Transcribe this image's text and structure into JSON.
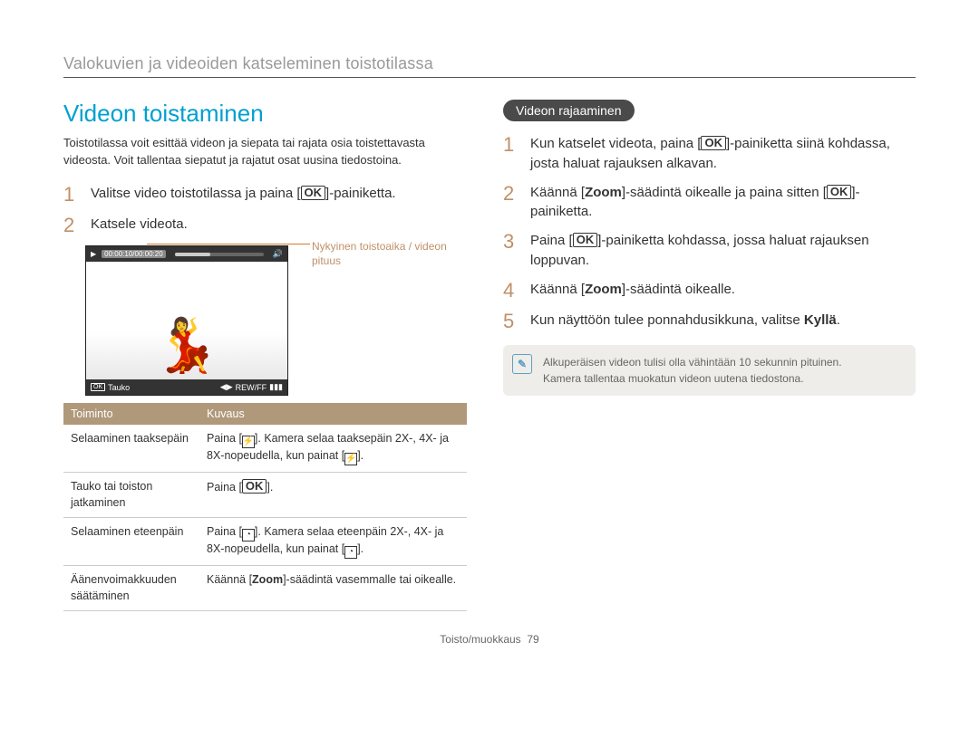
{
  "breadcrumb": "Valokuvien ja videoiden katseleminen toistotilassa",
  "left": {
    "title": "Videon toistaminen",
    "intro": "Toistotilassa voit esittää videon ja siepata tai rajata osia toistettavasta videosta. Voit tallentaa siepatut ja rajatut osat uusina tiedostoina.",
    "step1_pre": "Valitse video toistotilassa ja paina [",
    "step1_post": "]-painiketta.",
    "step2": "Katsele videota.",
    "caption": "Nykyinen toistoaika / videon pituus",
    "video": {
      "time": "00:00:10/00:00:20",
      "pause_label": "Tauko",
      "rewff_label": "REW/FF",
      "ok_small": "OK"
    },
    "table": {
      "h1": "Toiminto",
      "h2": "Kuvaus",
      "r1c1": "Selaaminen taaksepäin",
      "r1c2a": "Paina [",
      "r1c2b": "]. Kamera selaa taaksepäin 2X-, 4X- ja 8X-nopeudella, kun painat [",
      "r1c2c": "].",
      "r2c1": "Tauko tai toiston jatkaminen",
      "r2c2a": "Paina [",
      "r2c2b": "].",
      "r3c1": "Selaaminen eteenpäin",
      "r3c2a": "Paina [",
      "r3c2b": "]. Kamera selaa eteenpäin 2X-, 4X- ja 8X-nopeudella, kun painat [",
      "r3c2c": "].",
      "r4c1": "Äänenvoimakkuuden säätäminen",
      "r4c2a": "Käännä [",
      "r4c2b": "Zoom",
      "r4c2c": "]-säädintä vasemmalle tai oikealle."
    }
  },
  "right": {
    "pill": "Videon rajaaminen",
    "s1a": "Kun katselet videota, paina [",
    "s1b": "]-painiketta siinä kohdassa, josta haluat rajauksen alkavan.",
    "s2a": "Käännä [",
    "s2b": "Zoom",
    "s2c": "]-säädintä oikealle ja paina sitten [",
    "s2d": "]-painiketta.",
    "s3a": "Paina [",
    "s3b": "]-painiketta kohdassa, jossa haluat rajauksen loppuvan.",
    "s4a": "Käännä [",
    "s4b": "Zoom",
    "s4c": "]-säädintä oikealle.",
    "s5a": "Kun näyttöön tulee ponnahdusikkuna, valitse ",
    "s5b": "Kyllä",
    "s5c": ".",
    "note1": "Alkuperäisen videon tulisi olla vähintään 10 sekunnin pituinen.",
    "note2": "Kamera tallentaa muokatun videon uutena tiedostona."
  },
  "footer": {
    "section": "Toisto/muokkaus",
    "page": "79"
  }
}
